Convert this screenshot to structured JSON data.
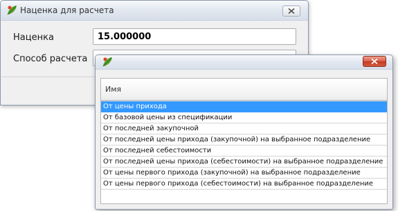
{
  "main_dialog": {
    "title": "Наценка для расчета",
    "close_icon": "close-icon",
    "fields": [
      {
        "label": "Наценка",
        "value": "15.000000"
      },
      {
        "label": "Способ расчета",
        "value": ""
      }
    ]
  },
  "popup": {
    "column_header": "Имя",
    "close_icon": "close-icon",
    "items": [
      "От цены прихода",
      "От базовой цены из спецификации",
      "От последней закупочной",
      "От последней цены прихода (закупочной) на выбранное подразделение",
      "От последней себестоимости",
      "От последней цены прихода (себестоимости) на выбранное подразделение",
      "От цены первого прихода (закупочной) на выбранное подразделение",
      "От цены первого прихода (себестоимости) на выбранное подразделение"
    ],
    "selected_index": 0
  },
  "colors": {
    "selection": "#3399ff",
    "close_red": "#c33b24"
  }
}
